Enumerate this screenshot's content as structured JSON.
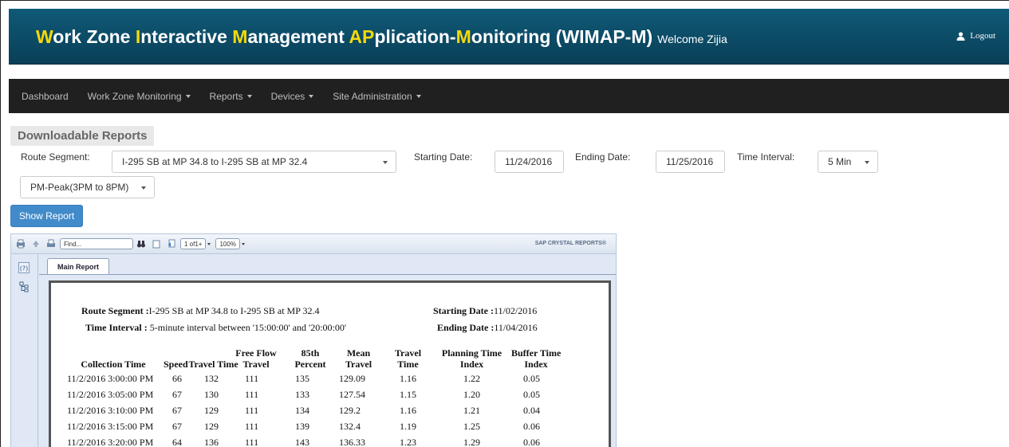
{
  "header": {
    "title_parts": [
      {
        "text": "W",
        "hl": true
      },
      {
        "text": "ork Zone ",
        "hl": false
      },
      {
        "text": "I",
        "hl": true
      },
      {
        "text": "nteractive ",
        "hl": false
      },
      {
        "text": "M",
        "hl": true
      },
      {
        "text": "anagement ",
        "hl": false
      },
      {
        "text": "AP",
        "hl": true
      },
      {
        "text": "plication-",
        "hl": false
      },
      {
        "text": "M",
        "hl": true
      },
      {
        "text": "onitoring (WIMAP-M)",
        "hl": false
      }
    ],
    "welcome": "Welcome Zijia",
    "logout_label": "Logout",
    "accent_color": "#f5d90a"
  },
  "navbar": {
    "items": [
      {
        "label": "Dashboard",
        "dropdown": false
      },
      {
        "label": "Work Zone Monitoring",
        "dropdown": true
      },
      {
        "label": "Reports",
        "dropdown": true
      },
      {
        "label": "Devices",
        "dropdown": true
      },
      {
        "label": "Site Administration",
        "dropdown": true
      }
    ]
  },
  "filters": {
    "heading": "Downloadable Reports",
    "route_segment_label": "Route Segment:",
    "route_segment_value": "I-295 SB at MP 34.8 to I-295 SB at MP 32.4",
    "starting_date_label": "Starting Date:",
    "starting_date_value": "11/24/2016",
    "ending_date_label": "Ending Date:",
    "ending_date_value": "11/25/2016",
    "time_interval_label": "Time Interval:",
    "time_interval_value": "5 Min",
    "peak_value": "PM-Peak(3PM to 8PM)",
    "show_report_label": "Show Report"
  },
  "viewer": {
    "find_placeholder": "Find...",
    "page_indicator": "1 of1+",
    "zoom": "100%",
    "brand": "SAP CRYSTAL REPORTS®",
    "tab_label": "Main Report"
  },
  "report": {
    "route_segment_label": "Route Segment :",
    "route_segment_value": "I-295 SB at MP 34.8 to I-295 SB at MP 32.4",
    "starting_date_label": "Starting Date :",
    "starting_date_value": "11/02/2016",
    "time_interval_label": "Time Interval :",
    "time_interval_value": "5-minute interval between '15:00:00' and '20:00:00'",
    "ending_date_label": "Ending Date :",
    "ending_date_value": "11/04/2016",
    "columns": [
      {
        "line1": "",
        "line2": "Collection Time"
      },
      {
        "line1": "",
        "line2": "Speed"
      },
      {
        "line1": "",
        "line2": "Travel Time"
      },
      {
        "line1": "Free Flow",
        "line2": "Travel"
      },
      {
        "line1": "85th",
        "line2": "Percent"
      },
      {
        "line1": "Mean",
        "line2": "Travel"
      },
      {
        "line1": "Travel",
        "line2": "Time"
      },
      {
        "line1": "Planning Time",
        "line2": "Index"
      },
      {
        "line1": "Buffer Time",
        "line2": "Index"
      }
    ],
    "rows": [
      [
        "11/2/2016 3:00:00 PM",
        "66",
        "132",
        "111",
        "135",
        "129.09",
        "1.16",
        "1.22",
        "0.05"
      ],
      [
        "11/2/2016 3:05:00 PM",
        "67",
        "130",
        "111",
        "133",
        "127.54",
        "1.15",
        "1.20",
        "0.05"
      ],
      [
        "11/2/2016 3:10:00 PM",
        "67",
        "129",
        "111",
        "134",
        "129.2",
        "1.16",
        "1.21",
        "0.04"
      ],
      [
        "11/2/2016 3:15:00 PM",
        "67",
        "129",
        "111",
        "139",
        "132.4",
        "1.19",
        "1.25",
        "0.06"
      ],
      [
        "11/2/2016 3:20:00 PM",
        "64",
        "136",
        "111",
        "143",
        "136.33",
        "1.23",
        "1.29",
        "0.06"
      ]
    ]
  }
}
